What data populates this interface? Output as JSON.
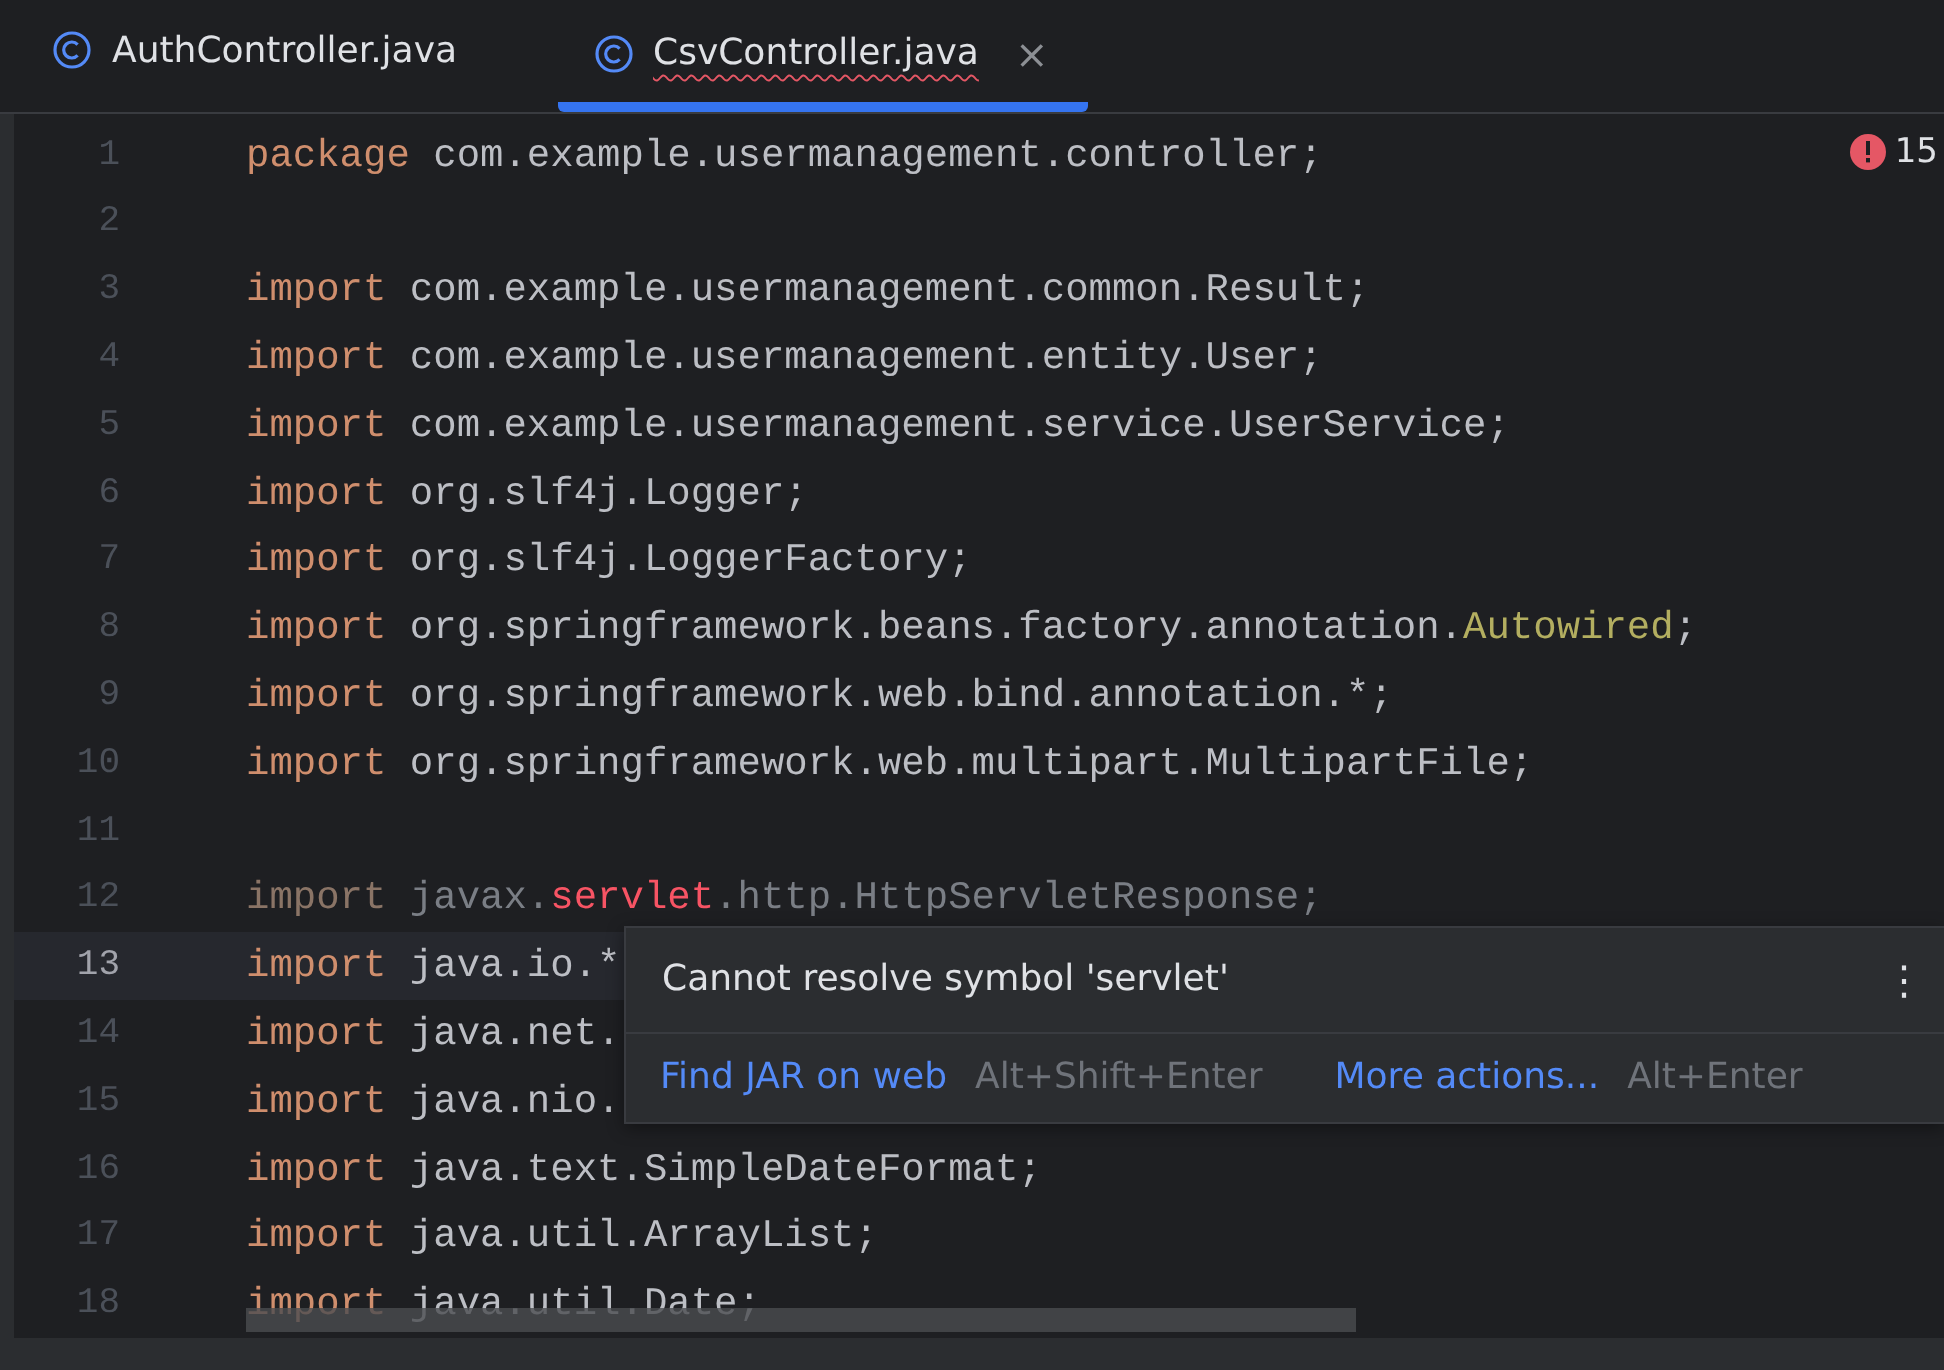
{
  "tabs": [
    {
      "label": "AuthController.java",
      "selected": false,
      "misspelled": false,
      "closable": false
    },
    {
      "label": "CsvController.java",
      "selected": true,
      "misspelled": true,
      "closable": true
    }
  ],
  "close_glyph": "×",
  "problems": {
    "count": "15"
  },
  "lines": [
    {
      "number": "1",
      "current": false,
      "unused": false,
      "tokens": [
        {
          "kind": "keyword",
          "text": "package"
        },
        {
          "kind": "plain",
          "text": " com.example.usermanagement.controller;"
        }
      ]
    },
    {
      "number": "2",
      "current": false
    },
    {
      "number": "3",
      "current": false,
      "unused": false,
      "tokens": [
        {
          "kind": "keyword",
          "text": "import"
        },
        {
          "kind": "plain",
          "text": " com.example.usermanagement.common.Result;"
        }
      ]
    },
    {
      "number": "4",
      "current": false,
      "unused": false,
      "tokens": [
        {
          "kind": "keyword",
          "text": "import"
        },
        {
          "kind": "plain",
          "text": " com.example.usermanagement.entity.User;"
        }
      ]
    },
    {
      "number": "5",
      "current": false,
      "unused": false,
      "tokens": [
        {
          "kind": "keyword",
          "text": "import"
        },
        {
          "kind": "plain",
          "text": " com.example.usermanagement.service.UserService;"
        }
      ]
    },
    {
      "number": "6",
      "current": false,
      "unused": false,
      "tokens": [
        {
          "kind": "keyword",
          "text": "import"
        },
        {
          "kind": "plain",
          "text": " org.slf4j.Logger;"
        }
      ]
    },
    {
      "number": "7",
      "current": false,
      "unused": false,
      "tokens": [
        {
          "kind": "keyword",
          "text": "import"
        },
        {
          "kind": "plain",
          "text": " org.slf4j.LoggerFactory;"
        }
      ]
    },
    {
      "number": "8",
      "current": false,
      "unused": false,
      "tokens": [
        {
          "kind": "keyword",
          "text": "import"
        },
        {
          "kind": "plain",
          "text": " org.springframework.beans.factory.annotation."
        },
        {
          "kind": "annotation",
          "text": "Autowired"
        },
        {
          "kind": "plain",
          "text": ";"
        }
      ]
    },
    {
      "number": "9",
      "current": false,
      "unused": false,
      "tokens": [
        {
          "kind": "keyword",
          "text": "import"
        },
        {
          "kind": "plain",
          "text": " org.springframework.web.bind.annotation.*;"
        }
      ]
    },
    {
      "number": "10",
      "current": false,
      "unused": false,
      "tokens": [
        {
          "kind": "keyword",
          "text": "import"
        },
        {
          "kind": "plain",
          "text": " org.springframework.web.multipart.MultipartFile;"
        }
      ]
    },
    {
      "number": "11",
      "current": false
    },
    {
      "number": "12",
      "current": false,
      "unused": true,
      "tokens": [
        {
          "kind": "keyword",
          "text": "import"
        },
        {
          "kind": "plain",
          "text": " javax."
        },
        {
          "kind": "error",
          "text": "servlet"
        },
        {
          "kind": "plain",
          "text": ".http.HttpServletResponse;"
        }
      ]
    },
    {
      "number": "13",
      "current": true,
      "unused": false,
      "tokens": [
        {
          "kind": "keyword",
          "text": "import"
        },
        {
          "kind": "plain",
          "text": " java.io.*"
        }
      ]
    },
    {
      "number": "14",
      "current": false,
      "unused": false,
      "tokens": [
        {
          "kind": "keyword",
          "text": "import"
        },
        {
          "kind": "plain",
          "text": " java.net."
        }
      ]
    },
    {
      "number": "15",
      "current": false,
      "unused": false,
      "tokens": [
        {
          "kind": "keyword",
          "text": "import"
        },
        {
          "kind": "plain",
          "text": " java.nio."
        }
      ]
    },
    {
      "number": "16",
      "current": false,
      "unused": false,
      "tokens": [
        {
          "kind": "keyword",
          "text": "import"
        },
        {
          "kind": "plain",
          "text": " java.text.SimpleDateFormat;"
        }
      ]
    },
    {
      "number": "17",
      "current": false,
      "unused": false,
      "tokens": [
        {
          "kind": "keyword",
          "text": "import"
        },
        {
          "kind": "plain",
          "text": " java.util.ArrayList;"
        }
      ]
    },
    {
      "number": "18",
      "current": false,
      "unused": false,
      "tokens": [
        {
          "kind": "keyword",
          "text": "import"
        },
        {
          "kind": "plain",
          "text": " java.util.Date;"
        }
      ]
    }
  ],
  "popup": {
    "message": "Cannot resolve symbol 'servlet'",
    "menu_glyph": "⋮",
    "actions": [
      {
        "label": "Find JAR on web",
        "shortcut": "Alt+Shift+Enter"
      },
      {
        "label": "More actions...",
        "shortcut": "Alt+Enter"
      }
    ]
  }
}
